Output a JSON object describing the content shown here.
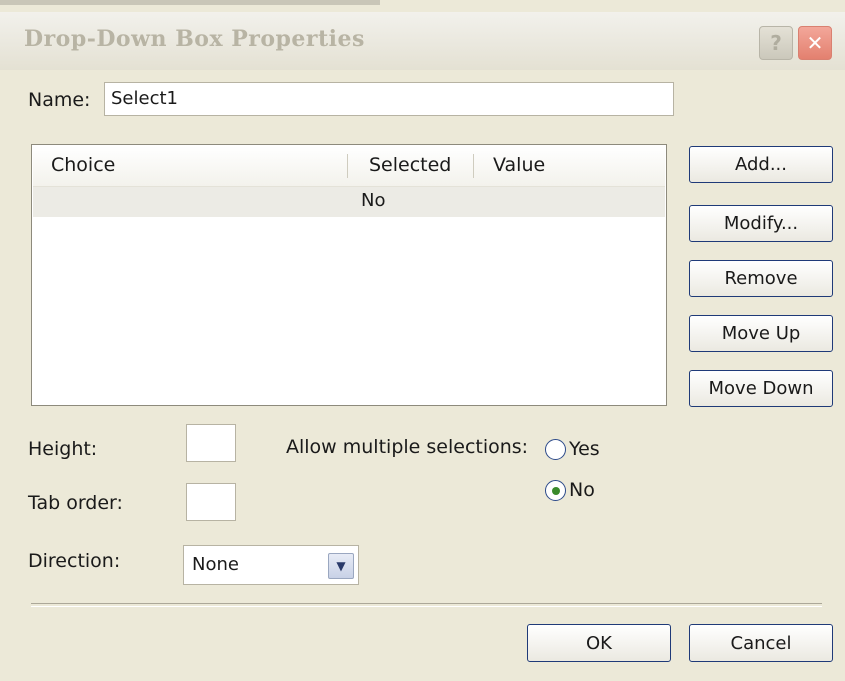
{
  "window": {
    "title": "Drop-Down Box Properties",
    "help_glyph": "?",
    "close_glyph": "✕"
  },
  "name": {
    "label": "Name:",
    "value": "Select1"
  },
  "list": {
    "columns": [
      "Choice",
      "Selected",
      "Value"
    ],
    "rows": [
      {
        "choice": "",
        "selected": "No",
        "value": ""
      }
    ]
  },
  "buttons": {
    "add": "Add...",
    "modify": "Modify...",
    "remove": "Remove",
    "move_up": "Move Up",
    "move_down": "Move Down"
  },
  "height": {
    "label": "Height:",
    "value": ""
  },
  "tab_order": {
    "label": "Tab order:",
    "value": ""
  },
  "multiple": {
    "label": "Allow multiple selections:",
    "yes": "Yes",
    "no": "No",
    "selected": "No"
  },
  "direction": {
    "label": "Direction:",
    "value": "None",
    "arrow_icon": "chevron-down-icon"
  },
  "footer": {
    "ok": "OK",
    "cancel": "Cancel"
  }
}
